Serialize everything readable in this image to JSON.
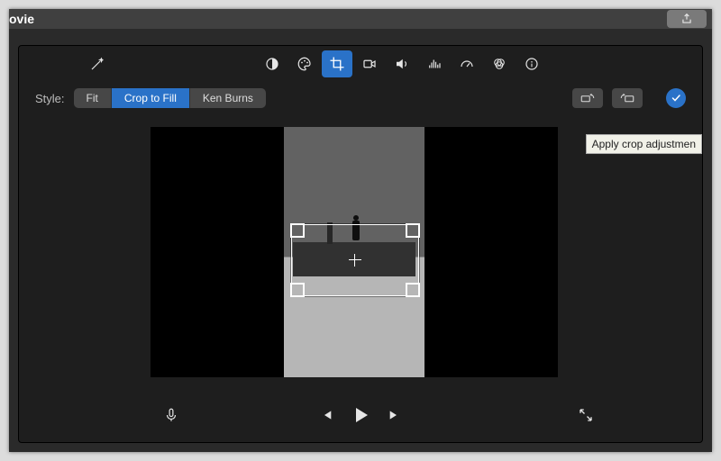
{
  "window": {
    "title": "ovie"
  },
  "toolbar": {
    "icons": [
      "contrast",
      "color-palette",
      "crop",
      "stabilize",
      "volume",
      "eq",
      "speedometer",
      "color-balance",
      "info"
    ],
    "selected": "crop"
  },
  "style": {
    "label": "Style:",
    "options": [
      "Fit",
      "Crop to Fill",
      "Ken Burns"
    ],
    "selected": "Crop to Fill"
  },
  "right": {
    "rotate_ccw": "rotate-ccw",
    "rotate_cw": "rotate-cw",
    "apply_tooltip": "Apply crop adjustmen"
  },
  "transport": {
    "mic": "microphone",
    "prev": "previous",
    "play": "play",
    "next": "next",
    "fullscreen": "fullscreen"
  }
}
